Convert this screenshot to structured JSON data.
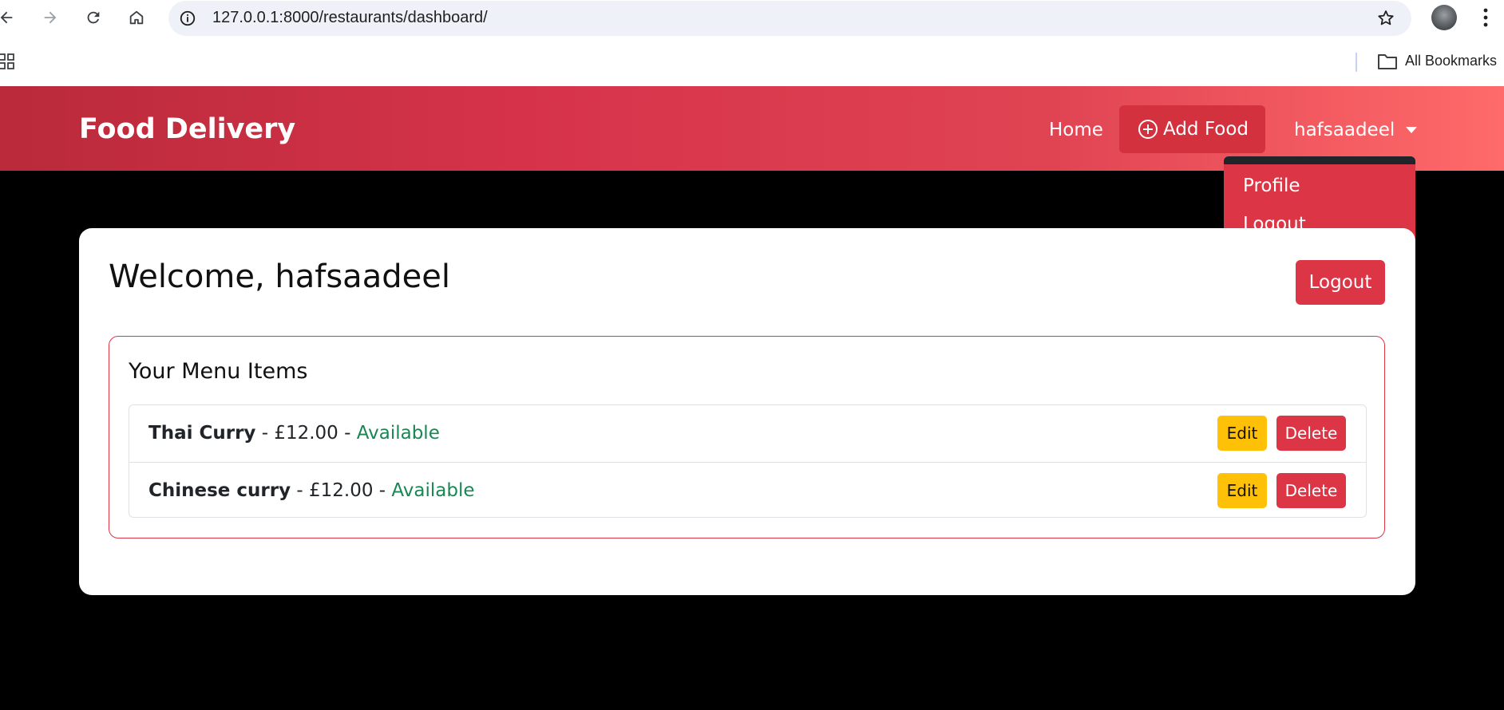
{
  "browser": {
    "url": "127.0.0.1:8000/restaurants/dashboard/",
    "bookmarks_label": "All Bookmarks"
  },
  "navbar": {
    "brand": "Food Delivery",
    "home": "Home",
    "add_food": "Add Food",
    "user": "hafsaadeel"
  },
  "dropdown": {
    "items": [
      {
        "label": "Profile"
      },
      {
        "label": "Logout"
      }
    ]
  },
  "main": {
    "welcome": "Welcome, hafsaadeel",
    "logout_button": "Logout",
    "menu_title": "Your Menu Items",
    "items": [
      {
        "name": "Thai Curry",
        "price": "£12.00",
        "status": "Available",
        "edit": "Edit",
        "delete": "Delete"
      },
      {
        "name": "Chinese curry",
        "price": "£12.00",
        "status": "Available",
        "edit": "Edit",
        "delete": "Delete"
      }
    ]
  },
  "colors": {
    "danger": "#dc3545",
    "warning": "#ffc107",
    "success": "#198754"
  }
}
